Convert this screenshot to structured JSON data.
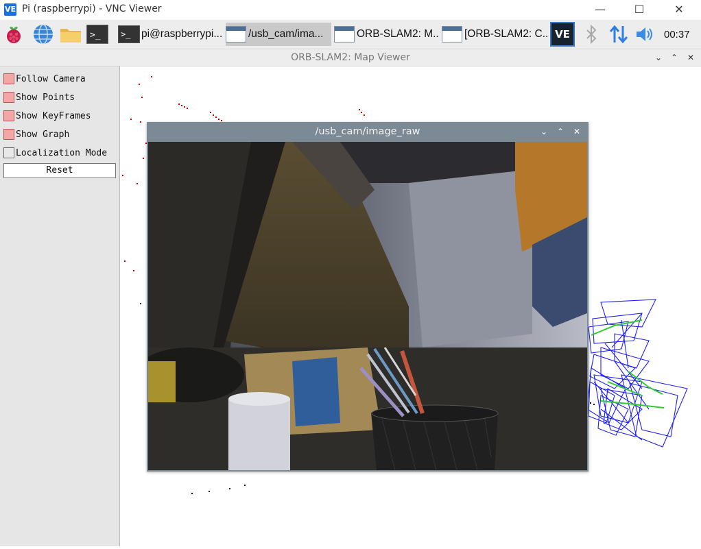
{
  "vnc_window": {
    "logo_text": "VE",
    "title": "Pi (raspberrypi) - VNC Viewer",
    "minimize": "—",
    "maximize": "☐",
    "close": "✕"
  },
  "taskbar": {
    "launchers": [
      "raspberry-menu-icon",
      "web-browser-icon",
      "file-manager-icon",
      "terminal-icon"
    ],
    "terminal_glyph": ">_",
    "tasks": [
      {
        "label": "pi@raspberrypi...",
        "icon": "terminal-icon",
        "active": false
      },
      {
        "label": "/usb_cam/ima...",
        "icon": "window-icon",
        "active": true
      },
      {
        "label": "ORB-SLAM2: M...",
        "icon": "window-icon",
        "active": false
      },
      {
        "label": "[ORB-SLAM2: C...",
        "icon": "window-icon",
        "active": false
      }
    ],
    "tray": [
      "vnc-tray-icon",
      "bluetooth-icon",
      "network-transfer-icon",
      "volume-icon"
    ],
    "vnc_tray_text": "VE",
    "clock": "00:37"
  },
  "map_viewer": {
    "title": "ORB-SLAM2: Map Viewer",
    "buttons": {
      "collapse": "⌄",
      "expand": "⌃",
      "close": "✕"
    },
    "panel": {
      "items": [
        {
          "label": "Follow Camera",
          "checked": true
        },
        {
          "label": "Show Points",
          "checked": true
        },
        {
          "label": "Show KeyFrames",
          "checked": true
        },
        {
          "label": "Show Graph",
          "checked": true
        },
        {
          "label": "Localization Mode",
          "checked": false
        }
      ],
      "reset_label": "Reset"
    },
    "colors": {
      "points": "#cc0000",
      "keyframes": "#1f1fff",
      "graph": "#2ecc2e",
      "checked": "#f3a6a6"
    }
  },
  "image_window": {
    "title": "/usb_cam/image_raw",
    "buttons": {
      "collapse": "⌄",
      "expand": "⌃",
      "close": "✕"
    }
  }
}
